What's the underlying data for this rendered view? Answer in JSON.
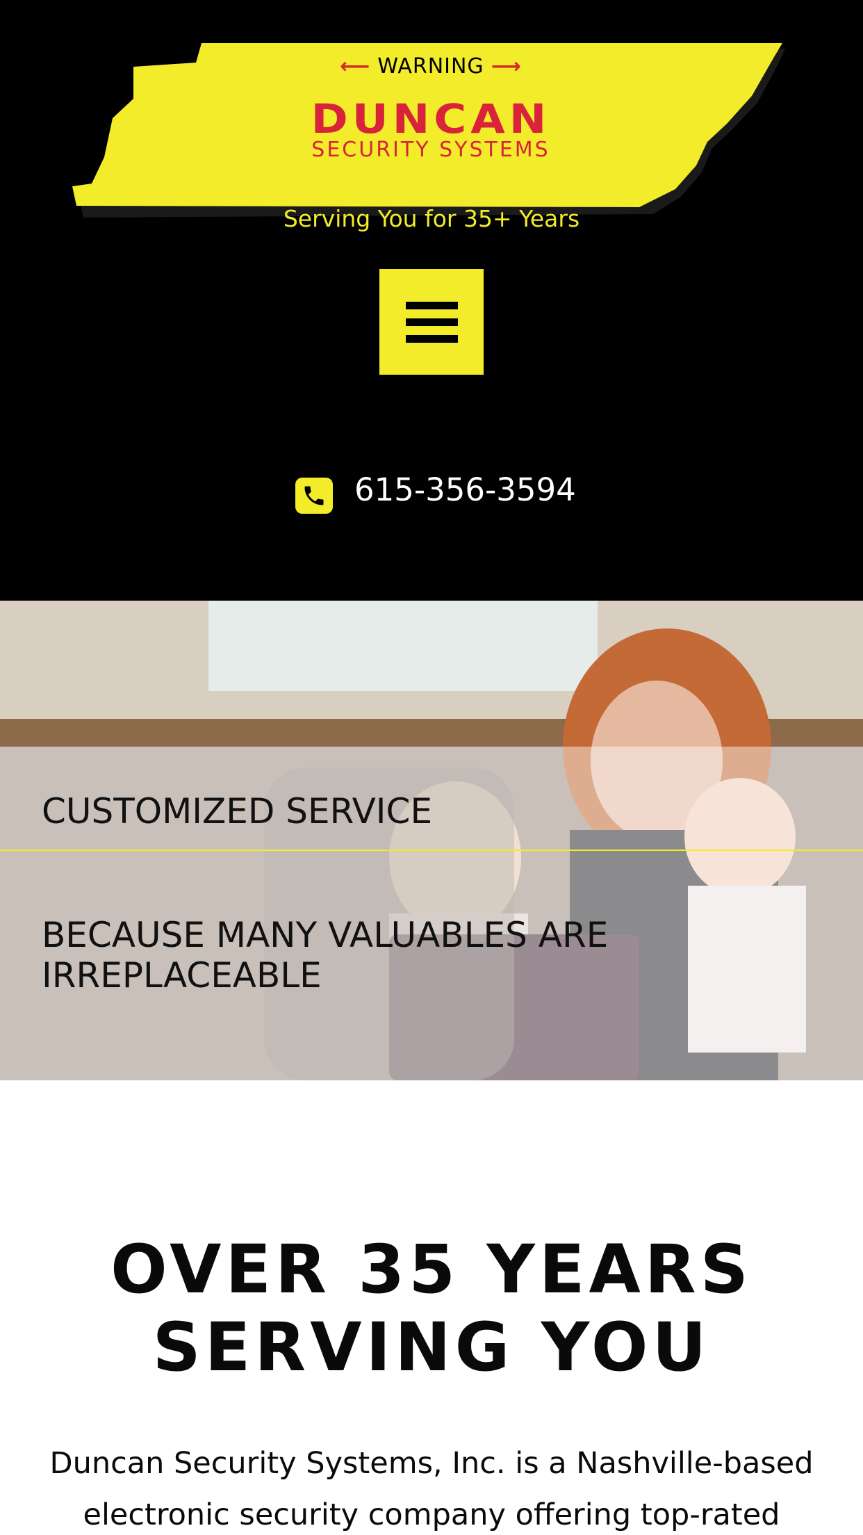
{
  "header": {
    "logo": {
      "warning": "WARNING",
      "name": "DUNCAN",
      "subtitle": "SECURITY SYSTEMS"
    },
    "tagline": "Serving You for 35+ Years",
    "menu_icon": "hamburger-menu-icon",
    "phone_icon": "phone-icon",
    "phone": "615-356-3594"
  },
  "hero": {
    "title": "CUSTOMIZED SERVICE",
    "subtitle": "BECAUSE MANY VALUABLES ARE IRREPLACEABLE"
  },
  "content": {
    "title_line1": "OVER 35 YEARS",
    "title_line2": "SERVING YOU",
    "body": "Duncan Security Systems, Inc. is a Nashville-based electronic security company offering top-rated products"
  },
  "colors": {
    "brand_yellow": "#f2ec2a",
    "brand_red": "#d8233a",
    "header_bg": "#000000"
  }
}
